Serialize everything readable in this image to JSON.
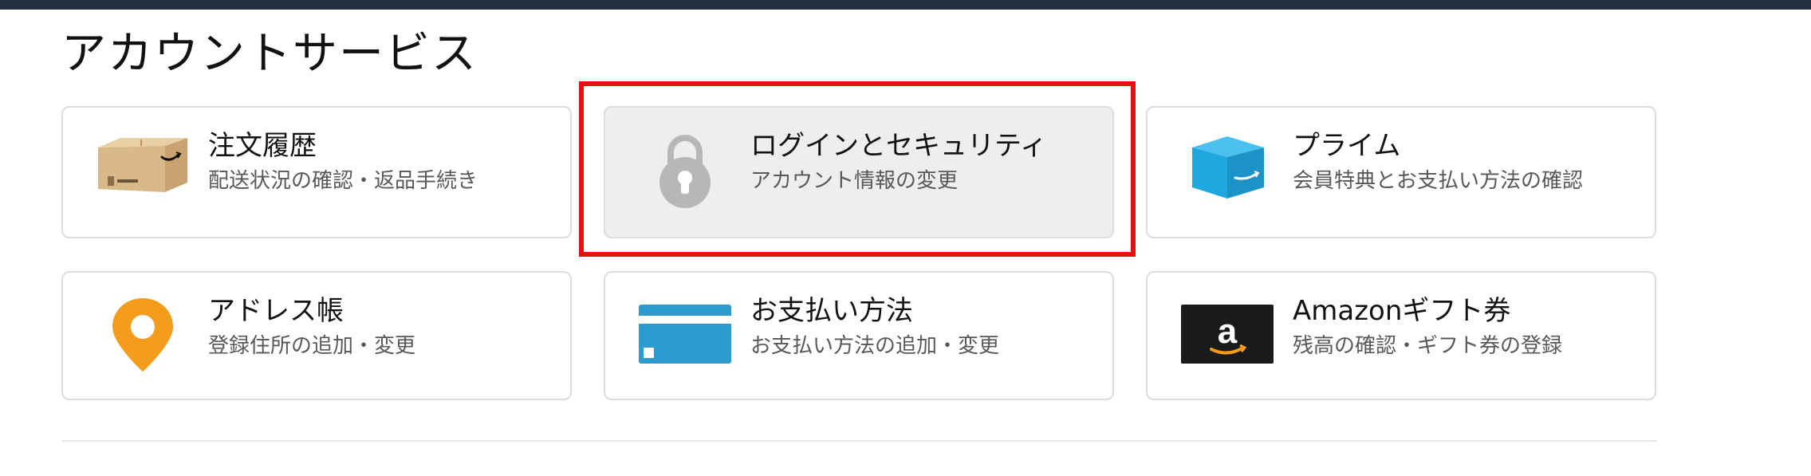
{
  "page": {
    "title": "アカウントサービス"
  },
  "cards": [
    {
      "title": "注文履歴",
      "desc": "配送状況の確認・返品手続き",
      "icon": "package-box-icon"
    },
    {
      "title": "ログインとセキュリティ",
      "desc": "アカウント情報の変更",
      "icon": "lock-icon",
      "highlighted": true
    },
    {
      "title": "プライム",
      "desc": "会員特典とお支払い方法の確認",
      "icon": "prime-box-icon"
    },
    {
      "title": "アドレス帳",
      "desc": "登録住所の追加・変更",
      "icon": "location-pin-icon"
    },
    {
      "title": "お支払い方法",
      "desc": "お支払い方法の追加・変更",
      "icon": "credit-card-icon"
    },
    {
      "title": "Amazonギフト券",
      "desc": "残高の確認・ギフト券の登録",
      "icon": "gift-card-icon"
    }
  ],
  "icons": {
    "gift_card_letter": "a"
  },
  "colors": {
    "topbar": "#232f3e",
    "highlight_border": "#e21212",
    "prime_blue": "#1fa7e0",
    "pin_orange": "#f49c1c",
    "card_blue": "#2b9ccd"
  }
}
